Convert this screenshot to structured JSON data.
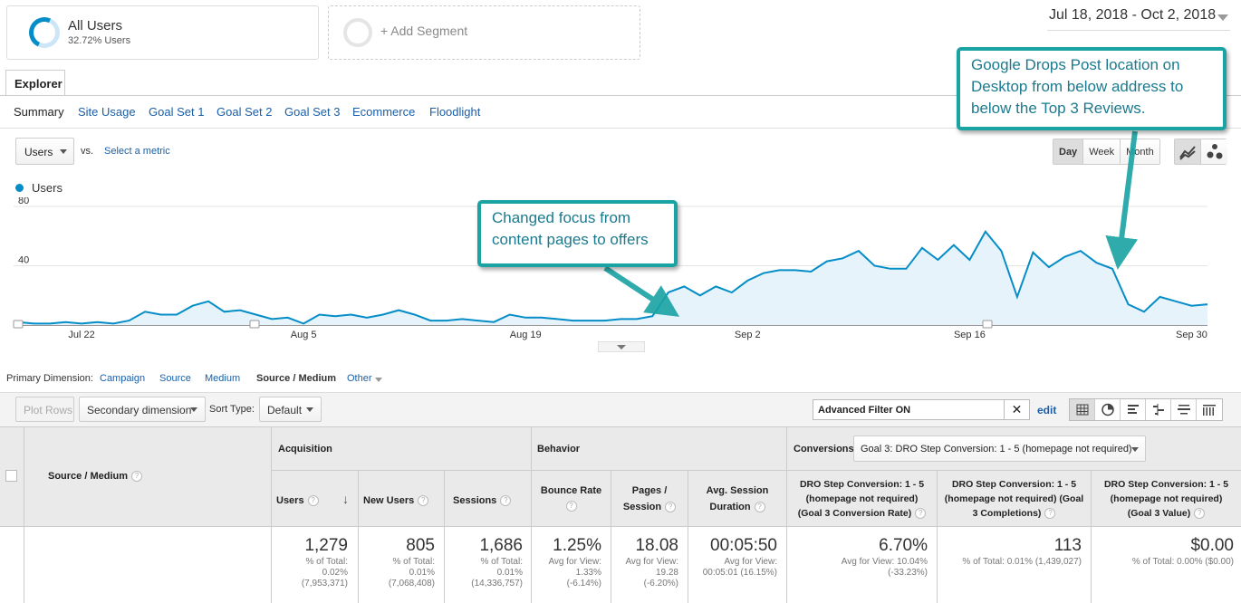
{
  "segments": {
    "all_users": {
      "name": "All Users",
      "subtitle": "32.72% Users"
    },
    "add_label": "+ Add Segment"
  },
  "date_range": "Jul 18, 2018 - Oct 2, 2018",
  "tabs": {
    "explorer": "Explorer"
  },
  "subtabs": [
    "Summary",
    "Site Usage",
    "Goal Set 1",
    "Goal Set 2",
    "Goal Set 3",
    "Ecommerce",
    "Floodlight"
  ],
  "metric": {
    "selected": "Users",
    "vs": "vs.",
    "select_metric": "Select a metric"
  },
  "period": [
    "Day",
    "Week",
    "Month"
  ],
  "colors": {
    "accent": "#058dc7",
    "link": "#1a5fa8",
    "callout": "#1aa3a3"
  },
  "chart_data": {
    "type": "area",
    "legend": [
      "Users"
    ],
    "y_ticks": [
      "80",
      "40"
    ],
    "ylim": [
      0,
      80
    ],
    "x_ticks": [
      "Jul 22",
      "Aug 5",
      "Aug 19",
      "Sep 2",
      "Sep 16",
      "Sep 30"
    ],
    "x": [
      "Jul 18",
      "Jul 19",
      "Jul 20",
      "Jul 21",
      "Jul 22",
      "Jul 23",
      "Jul 24",
      "Jul 25",
      "Jul 26",
      "Jul 27",
      "Jul 28",
      "Jul 29",
      "Jul 30",
      "Jul 31",
      "Aug 1",
      "Aug 2",
      "Aug 3",
      "Aug 4",
      "Aug 5",
      "Aug 6",
      "Aug 7",
      "Aug 8",
      "Aug 9",
      "Aug 10",
      "Aug 11",
      "Aug 12",
      "Aug 13",
      "Aug 14",
      "Aug 15",
      "Aug 16",
      "Aug 17",
      "Aug 18",
      "Aug 19",
      "Aug 20",
      "Aug 21",
      "Aug 22",
      "Aug 23",
      "Aug 24",
      "Aug 25",
      "Aug 26",
      "Aug 27",
      "Aug 28",
      "Aug 29",
      "Aug 30",
      "Aug 31",
      "Sep 1",
      "Sep 2",
      "Sep 3",
      "Sep 4",
      "Sep 5",
      "Sep 6",
      "Sep 7",
      "Sep 8",
      "Sep 9",
      "Sep 10",
      "Sep 11",
      "Sep 12",
      "Sep 13",
      "Sep 14",
      "Sep 15",
      "Sep 16",
      "Sep 17",
      "Sep 18",
      "Sep 19",
      "Sep 20",
      "Sep 21",
      "Sep 22",
      "Sep 23",
      "Sep 24",
      "Sep 25",
      "Sep 26",
      "Sep 27",
      "Sep 28",
      "Sep 29",
      "Sep 30",
      "Oct 1",
      "Oct 2"
    ],
    "series": [
      {
        "name": "Users",
        "values": [
          2,
          1,
          1,
          2,
          1,
          2,
          1,
          3,
          9,
          7,
          7,
          13,
          16,
          9,
          10,
          7,
          4,
          5,
          1,
          7,
          6,
          7,
          5,
          7,
          10,
          7,
          3,
          3,
          4,
          3,
          2,
          7,
          5,
          5,
          4,
          3,
          3,
          3,
          4,
          4,
          6,
          22,
          26,
          20,
          26,
          22,
          30,
          35,
          37,
          37,
          36,
          43,
          45,
          50,
          40,
          38,
          38,
          52,
          44,
          54,
          44,
          63,
          50,
          19,
          49,
          39,
          46,
          50,
          42,
          38,
          14,
          9,
          19,
          16,
          13,
          14
        ]
      }
    ]
  },
  "annotations": {
    "callout_1": "Changed focus from content pages to offers",
    "callout_2": "Google Drops Post location on Desktop from below address to below the Top 3 Reviews."
  },
  "primary_dimension": {
    "label": "Primary Dimension:",
    "options": [
      "Campaign",
      "Source",
      "Medium",
      "Source / Medium",
      "Other"
    ]
  },
  "toolbar": {
    "plot_rows": "Plot Rows",
    "secondary_dimension": "Secondary dimension",
    "sort_type_label": "Sort Type:",
    "sort_type_value": "Default",
    "advanced_filter": "Advanced Filter ON",
    "edit": "edit"
  },
  "table": {
    "dimension_header": "Source / Medium",
    "groups": {
      "acquisition": "Acquisition",
      "behavior": "Behavior",
      "conversions": "Conversions"
    },
    "conversion_select": "Goal 3: DRO Step Conversion: 1 - 5 (homepage not required)",
    "columns": {
      "users": "Users",
      "new_users": "New Users",
      "sessions": "Sessions",
      "bounce_rate": "Bounce Rate",
      "pages_session_1": "Pages /",
      "pages_session_2": "Session",
      "avg_dur_1": "Avg. Session",
      "avg_dur_2": "Duration",
      "conv_rate_1": "DRO Step Conversion: 1 - 5",
      "conv_rate_2": "(homepage not required)",
      "conv_rate_3": "(Goal 3 Conversion Rate)",
      "completions_1": "DRO Step Conversion: 1 - 5",
      "completions_2": "(homepage not required) (Goal",
      "completions_3": "3 Completions)",
      "value_1": "DRO Step Conversion: 1 - 5",
      "value_2": "(homepage not required)",
      "value_3": "(Goal 3 Value)"
    },
    "totals": {
      "users": {
        "value": "1,279",
        "l1": "% of Total:",
        "l2": "0.02%",
        "l3": "(7,953,371)"
      },
      "new_users": {
        "value": "805",
        "l1": "% of Total:",
        "l2": "0.01%",
        "l3": "(7,068,408)"
      },
      "sessions": {
        "value": "1,686",
        "l1": "% of Total:",
        "l2": "0.01%",
        "l3": "(14,336,757)"
      },
      "bounce_rate": {
        "value": "1.25%",
        "l1": "Avg for View:",
        "l2": "1.33%",
        "l3": "(-6.14%)"
      },
      "pages_session": {
        "value": "18.08",
        "l1": "Avg for View:",
        "l2": "19.28",
        "l3": "(-6.20%)"
      },
      "avg_dur": {
        "value": "00:05:50",
        "l1": "Avg for View:",
        "l2": "00:05:01 (16.15%)"
      },
      "conv_rate": {
        "value": "6.70%",
        "l1": "Avg for View: 10.04%",
        "l2": "(-33.23%)"
      },
      "completions": {
        "value": "113",
        "l1": "% of Total: 0.01% (1,439,027)"
      },
      "goal_value": {
        "value": "$0.00",
        "l1": "% of Total: 0.00% ($0.00)"
      }
    }
  }
}
